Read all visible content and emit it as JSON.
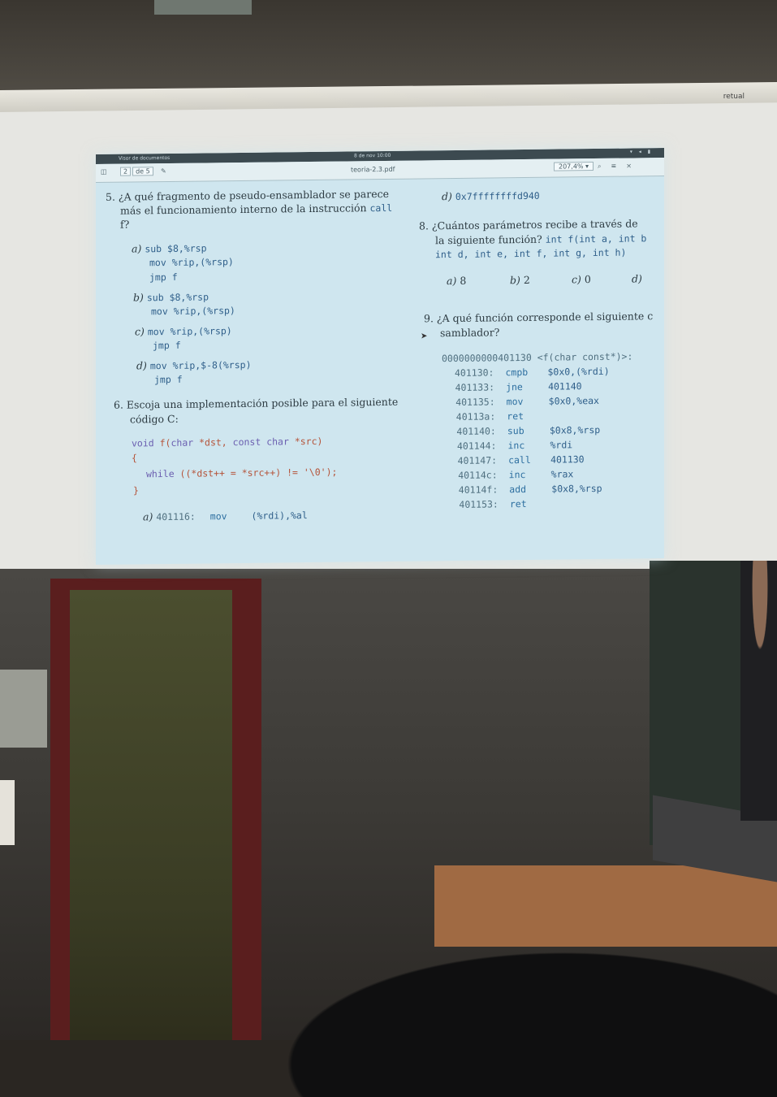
{
  "projector": {
    "brand": "retual"
  },
  "status_bar": {
    "app": "Visor de documentos",
    "clock": "8 de nov 10:00",
    "tray": "▾ ◂ ▮"
  },
  "toolbar": {
    "page": "2",
    "page_total": "de 5",
    "filename": "teoria-2.3.pdf",
    "zoom": "207,4% ▾",
    "icons": {
      "sidebar": "sidebar-icon",
      "annotate": "pen-icon",
      "search": "search-icon",
      "menu": "menu-icon",
      "close": "close-icon"
    }
  },
  "left": {
    "q5": {
      "num": "5.",
      "line1": "¿A qué fragmento de pseudo-ensamblador se parece",
      "line2_pre": "más el funcionamiento interno de la instrucción ",
      "line2_code": "call",
      "line3": "f?",
      "options": [
        {
          "label": "a)",
          "lines": [
            "sub $8,%rsp",
            "mov %rip,(%rsp)",
            "jmp f"
          ]
        },
        {
          "label": "b)",
          "lines": [
            "sub $8,%rsp",
            "mov %rip,(%rsp)"
          ]
        },
        {
          "label": "c)",
          "lines": [
            "mov %rip,(%rsp)",
            "jmp f"
          ]
        },
        {
          "label": "d)",
          "lines": [
            "mov %rip,$-8(%rsp)",
            "jmp f"
          ]
        }
      ]
    },
    "q6": {
      "num": "6.",
      "line1": "Escoja una implementación posible para el siguiente",
      "line2": "código C:",
      "code": {
        "kw_void": "void",
        "fname": " f(",
        "kw_char": "char",
        "p1": " *dst, ",
        "kw_const": "const",
        "kw_char2": " char",
        "p2": " *src)",
        "open": "{",
        "kw_while": "while",
        "body": " ((*dst++ = *src++) != ",
        "lit": "'\\0'",
        "end": ");",
        "close": "}"
      },
      "answer": {
        "label": "a)",
        "addr": "401116:",
        "op": "mov",
        "args": "(%rdi),%al"
      }
    }
  },
  "right": {
    "q7d": {
      "label": "d)",
      "value": "0x7ffffffffd940"
    },
    "q8": {
      "num": "8.",
      "line1": "¿Cuántos parámetros recibe a través de",
      "line2_pre": "la siguiente función? ",
      "line2_code": "int f(int a, int b",
      "line3": "int d, int e, int f, int g, int h)",
      "options": [
        {
          "label": "a)",
          "value": "8"
        },
        {
          "label": "b)",
          "value": "2"
        },
        {
          "label": "c)",
          "value": "0"
        },
        {
          "label": "d)",
          "value": ""
        }
      ]
    },
    "q9": {
      "num": "9.",
      "line1": "¿A qué función corresponde el siguiente c",
      "line2": "samblador?",
      "header": "0000000000401130 <f(char const*)>:",
      "rows": [
        {
          "addr": "401130:",
          "op": "cmpb",
          "args": "$0x0,(%rdi)"
        },
        {
          "addr": "401133:",
          "op": "jne",
          "args": "401140"
        },
        {
          "addr": "401135:",
          "op": "mov",
          "args": "$0x0,%eax"
        },
        {
          "addr": "40113a:",
          "op": "ret",
          "args": ""
        },
        {
          "addr": "401140:",
          "op": "sub",
          "args": "$0x8,%rsp"
        },
        {
          "addr": "401144:",
          "op": "inc",
          "args": "%rdi"
        },
        {
          "addr": "401147:",
          "op": "call",
          "args": "401130"
        },
        {
          "addr": "40114c:",
          "op": "inc",
          "args": "%rax"
        },
        {
          "addr": "40114f:",
          "op": "add",
          "args": "$0x8,%rsp"
        },
        {
          "addr": "401153:",
          "op": "ret",
          "args": ""
        }
      ]
    }
  }
}
